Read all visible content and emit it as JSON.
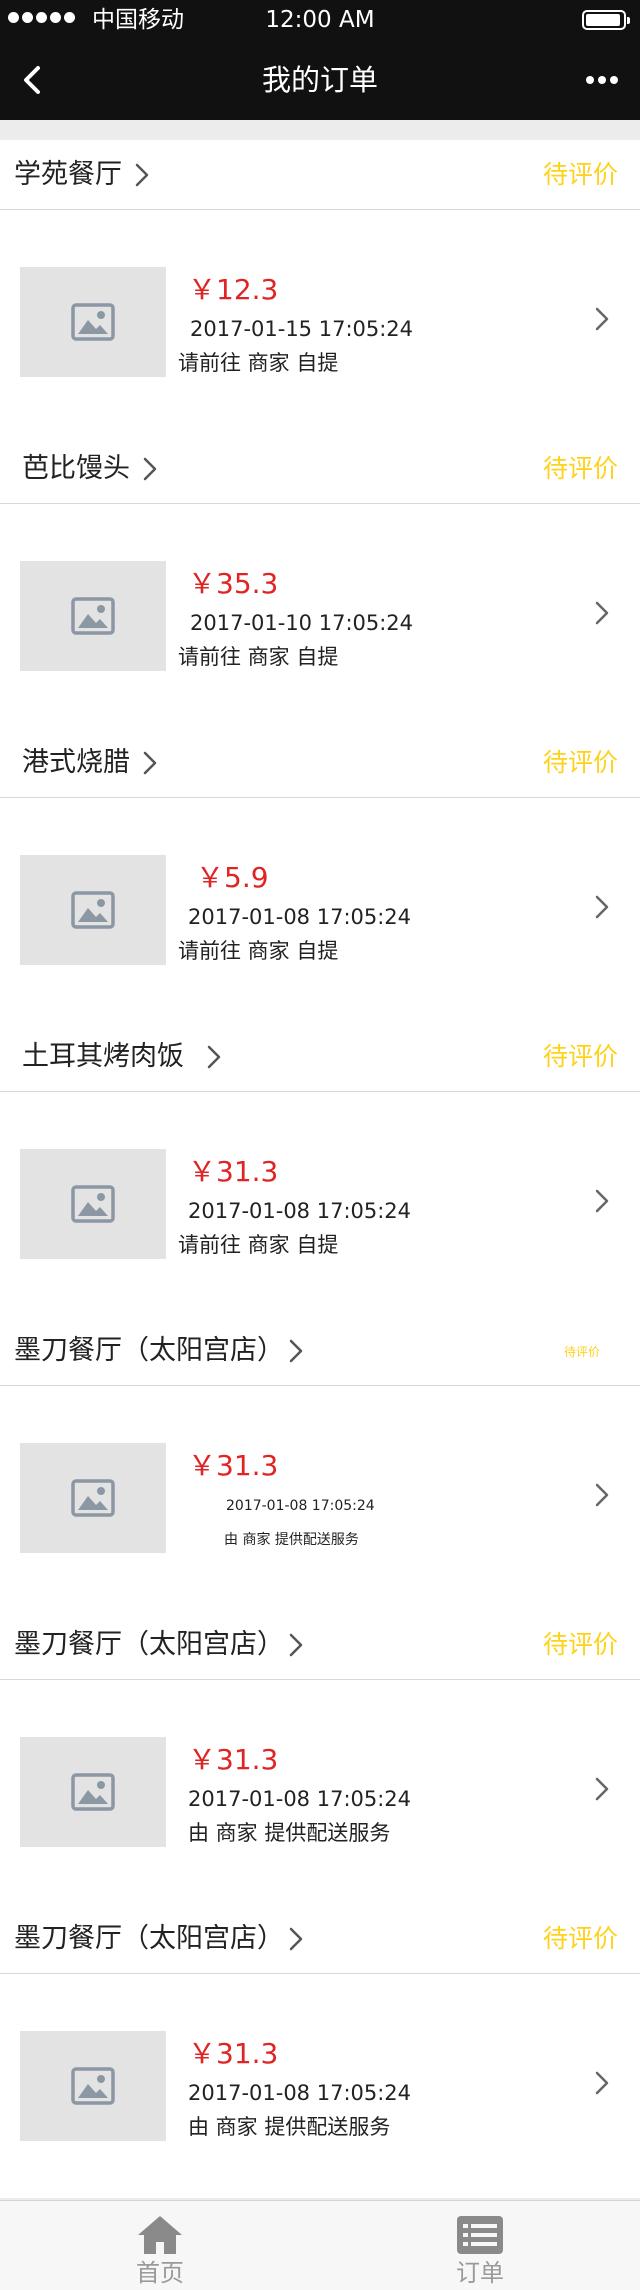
{
  "status_bar": {
    "carrier": "中国移动",
    "time": "12:00 AM"
  },
  "nav": {
    "title": "我的订单"
  },
  "orders": [
    {
      "shop": "学苑餐厅",
      "status": "待评价",
      "price": "￥12.3",
      "date": "2017-01-15 17:05:24",
      "delivery": "请前往 商家 自提"
    },
    {
      "shop": "芭比馒头",
      "status": "待评价",
      "price": "￥35.3",
      "date": "2017-01-10 17:05:24",
      "delivery": "请前往 商家 自提"
    },
    {
      "shop": "港式烧腊",
      "status": "待评价",
      "price": "￥5.9",
      "date": "2017-01-08 17:05:24",
      "delivery": "请前往 商家 自提"
    },
    {
      "shop": "土耳其烤肉饭",
      "status": "待评价",
      "price": "￥31.3",
      "date": "2017-01-08 17:05:24",
      "delivery": "请前往 商家 自提"
    },
    {
      "shop": "墨刀餐厅（太阳宫店）",
      "status": "待评价",
      "price": "￥31.3",
      "date": "2017-01-08 17:05:24",
      "delivery": "由 商家 提供配送服务"
    },
    {
      "shop": "墨刀餐厅（太阳宫店）",
      "status": "待评价",
      "price": "￥31.3",
      "date": "2017-01-08 17:05:24",
      "delivery": "由 商家 提供配送服务"
    },
    {
      "shop": "墨刀餐厅（太阳宫店）",
      "status": "待评价",
      "price": "￥31.3",
      "date": "2017-01-08 17:05:24",
      "delivery": "由 商家 提供配送服务"
    }
  ],
  "tabs": [
    {
      "label": "首页",
      "icon": "home-icon"
    },
    {
      "label": "订单",
      "icon": "order-list-icon"
    }
  ],
  "colors": {
    "status_yellow": "#ffd21a",
    "price_red": "#e02424",
    "bar_black": "#111111"
  }
}
